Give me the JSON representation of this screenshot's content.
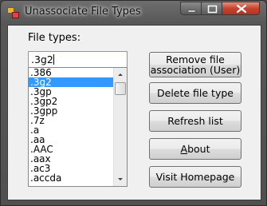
{
  "window": {
    "title": "Unassociate File Types"
  },
  "file_types_label": "File types:",
  "file_type_input": {
    "value": ".3g2"
  },
  "file_type_list": {
    "items": [
      ".386",
      ".3g2",
      ".3gp",
      ".3gp2",
      ".3gpp",
      ".7z",
      ".a",
      ".aa",
      ".AAC",
      ".aax",
      ".ac3",
      ".accda"
    ],
    "selected": ".3g2"
  },
  "buttons": {
    "remove_association_line1": "Remove file",
    "remove_association_line2": "association (User)",
    "delete_file_type": "Delete file type",
    "refresh_list": "Refresh list",
    "about": "About",
    "visit_homepage": "Visit Homepage"
  },
  "colors": {
    "selection": "#3399ff",
    "close_button": "#c6452f"
  }
}
